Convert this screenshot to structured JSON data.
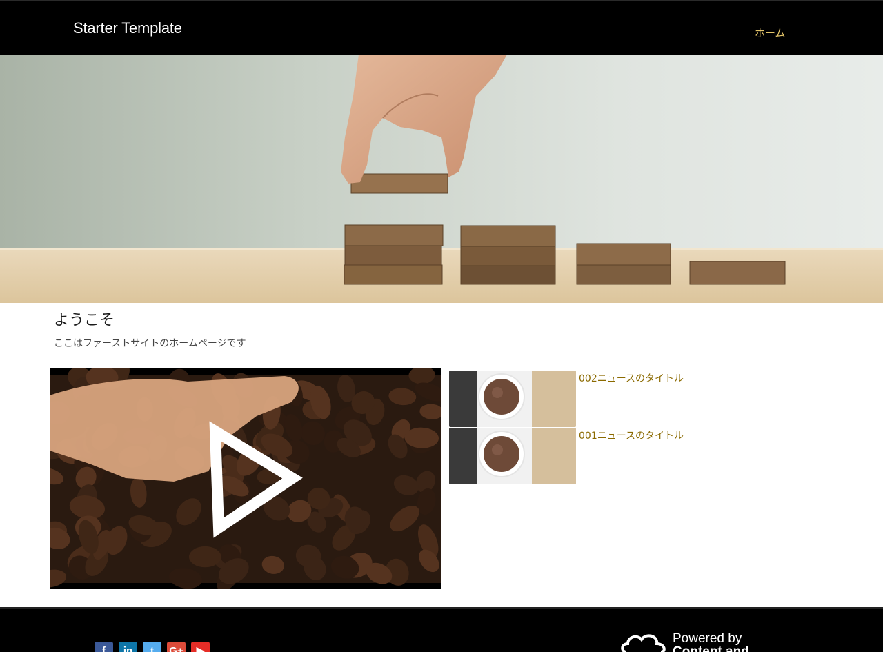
{
  "header": {
    "brand": "Starter Template",
    "nav": [
      {
        "label": "ホーム"
      }
    ]
  },
  "welcome": {
    "title": "ようこそ",
    "text": "ここはファーストサイトのホームページです"
  },
  "news": [
    {
      "title": "002ニュースのタイトル"
    },
    {
      "title": "001ニュースのタイトル"
    }
  ],
  "footer": {
    "social": [
      {
        "name": "facebook",
        "glyph": "f",
        "color": "#3b5998"
      },
      {
        "name": "linkedin",
        "glyph": "in",
        "color": "#0e76a8"
      },
      {
        "name": "twitter",
        "glyph": "t",
        "color": "#55acee"
      },
      {
        "name": "google-plus",
        "glyph": "G+",
        "color": "#dd4b39"
      },
      {
        "name": "youtube",
        "glyph": "▶",
        "color": "#e52d27"
      }
    ],
    "powered_by": "Powered by",
    "powered_brand": "Content and"
  },
  "colors": {
    "accent": "#e4c56a",
    "link": "#8b6a00",
    "header_bg": "#000000"
  }
}
